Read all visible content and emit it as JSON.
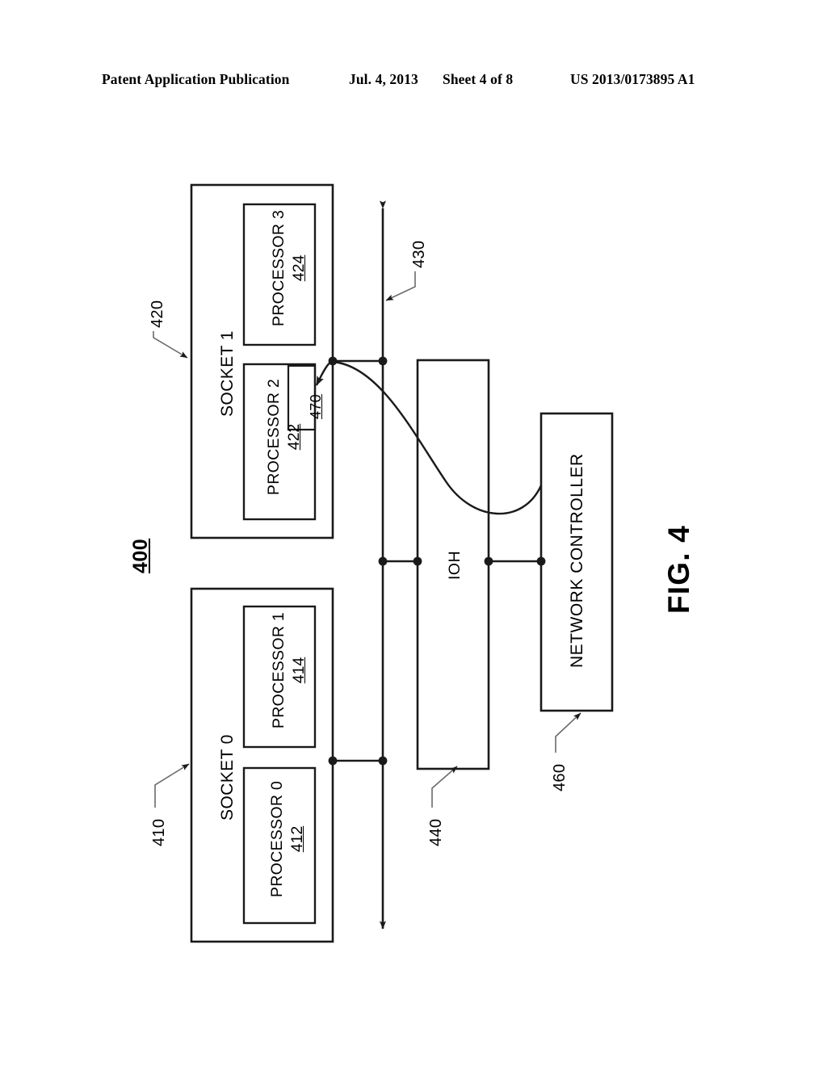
{
  "header": {
    "publication": "Patent Application Publication",
    "date": "Jul. 4, 2013",
    "sheet": "Sheet 4 of 8",
    "patent_number": "US 2013/0173895 A1"
  },
  "figure": {
    "label": "FIG. 4",
    "system_ref": "400"
  },
  "blocks": {
    "socket0": {
      "title": "SOCKET 0",
      "ref": "410",
      "processors": [
        {
          "name": "PROCESSOR 0",
          "ref": "412"
        },
        {
          "name": "PROCESSOR 1",
          "ref": "414"
        }
      ]
    },
    "socket1": {
      "title": "SOCKET 1",
      "ref": "420",
      "processors": [
        {
          "name": "PROCESSOR 2",
          "ref": "422",
          "inner_ref": "470"
        },
        {
          "name": "PROCESSOR 3",
          "ref": "424"
        }
      ]
    },
    "ioh": {
      "title": "IOH",
      "ref": "440"
    },
    "network_controller": {
      "title": "NETWORK CONTROLLER",
      "ref": "460"
    },
    "bus": {
      "ref": "430"
    }
  },
  "style": {
    "line_color": "#1a1a1a",
    "leader_color": "#4d4d4d",
    "background": "#ffffff"
  }
}
